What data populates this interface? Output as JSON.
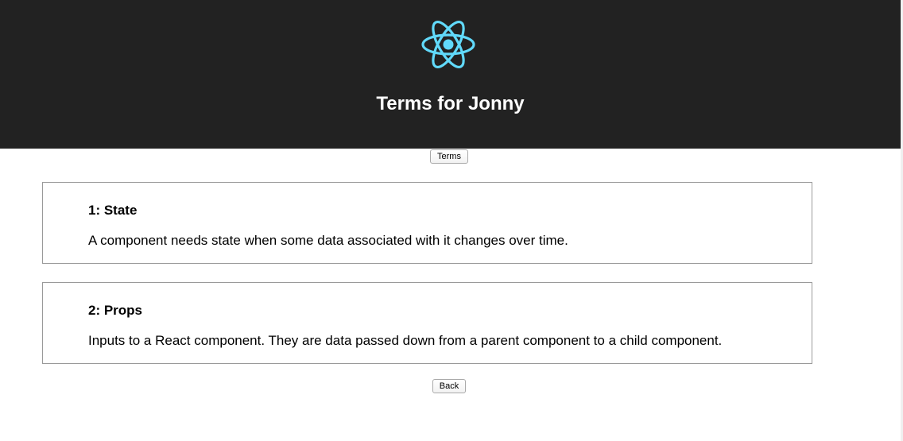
{
  "header": {
    "logo_icon": "react-logo-icon",
    "title": "Terms for Jonny",
    "background_color": "#222222",
    "logo_color": "#61dafb"
  },
  "nav": {
    "terms_label": "Terms"
  },
  "terms": [
    {
      "title": "1: State",
      "description": "A component needs state when some data associated with it changes over time."
    },
    {
      "title": "2: Props",
      "description": "Inputs to a React component. They are data passed down from a parent component to a child component."
    }
  ],
  "footer": {
    "back_label": "Back"
  }
}
